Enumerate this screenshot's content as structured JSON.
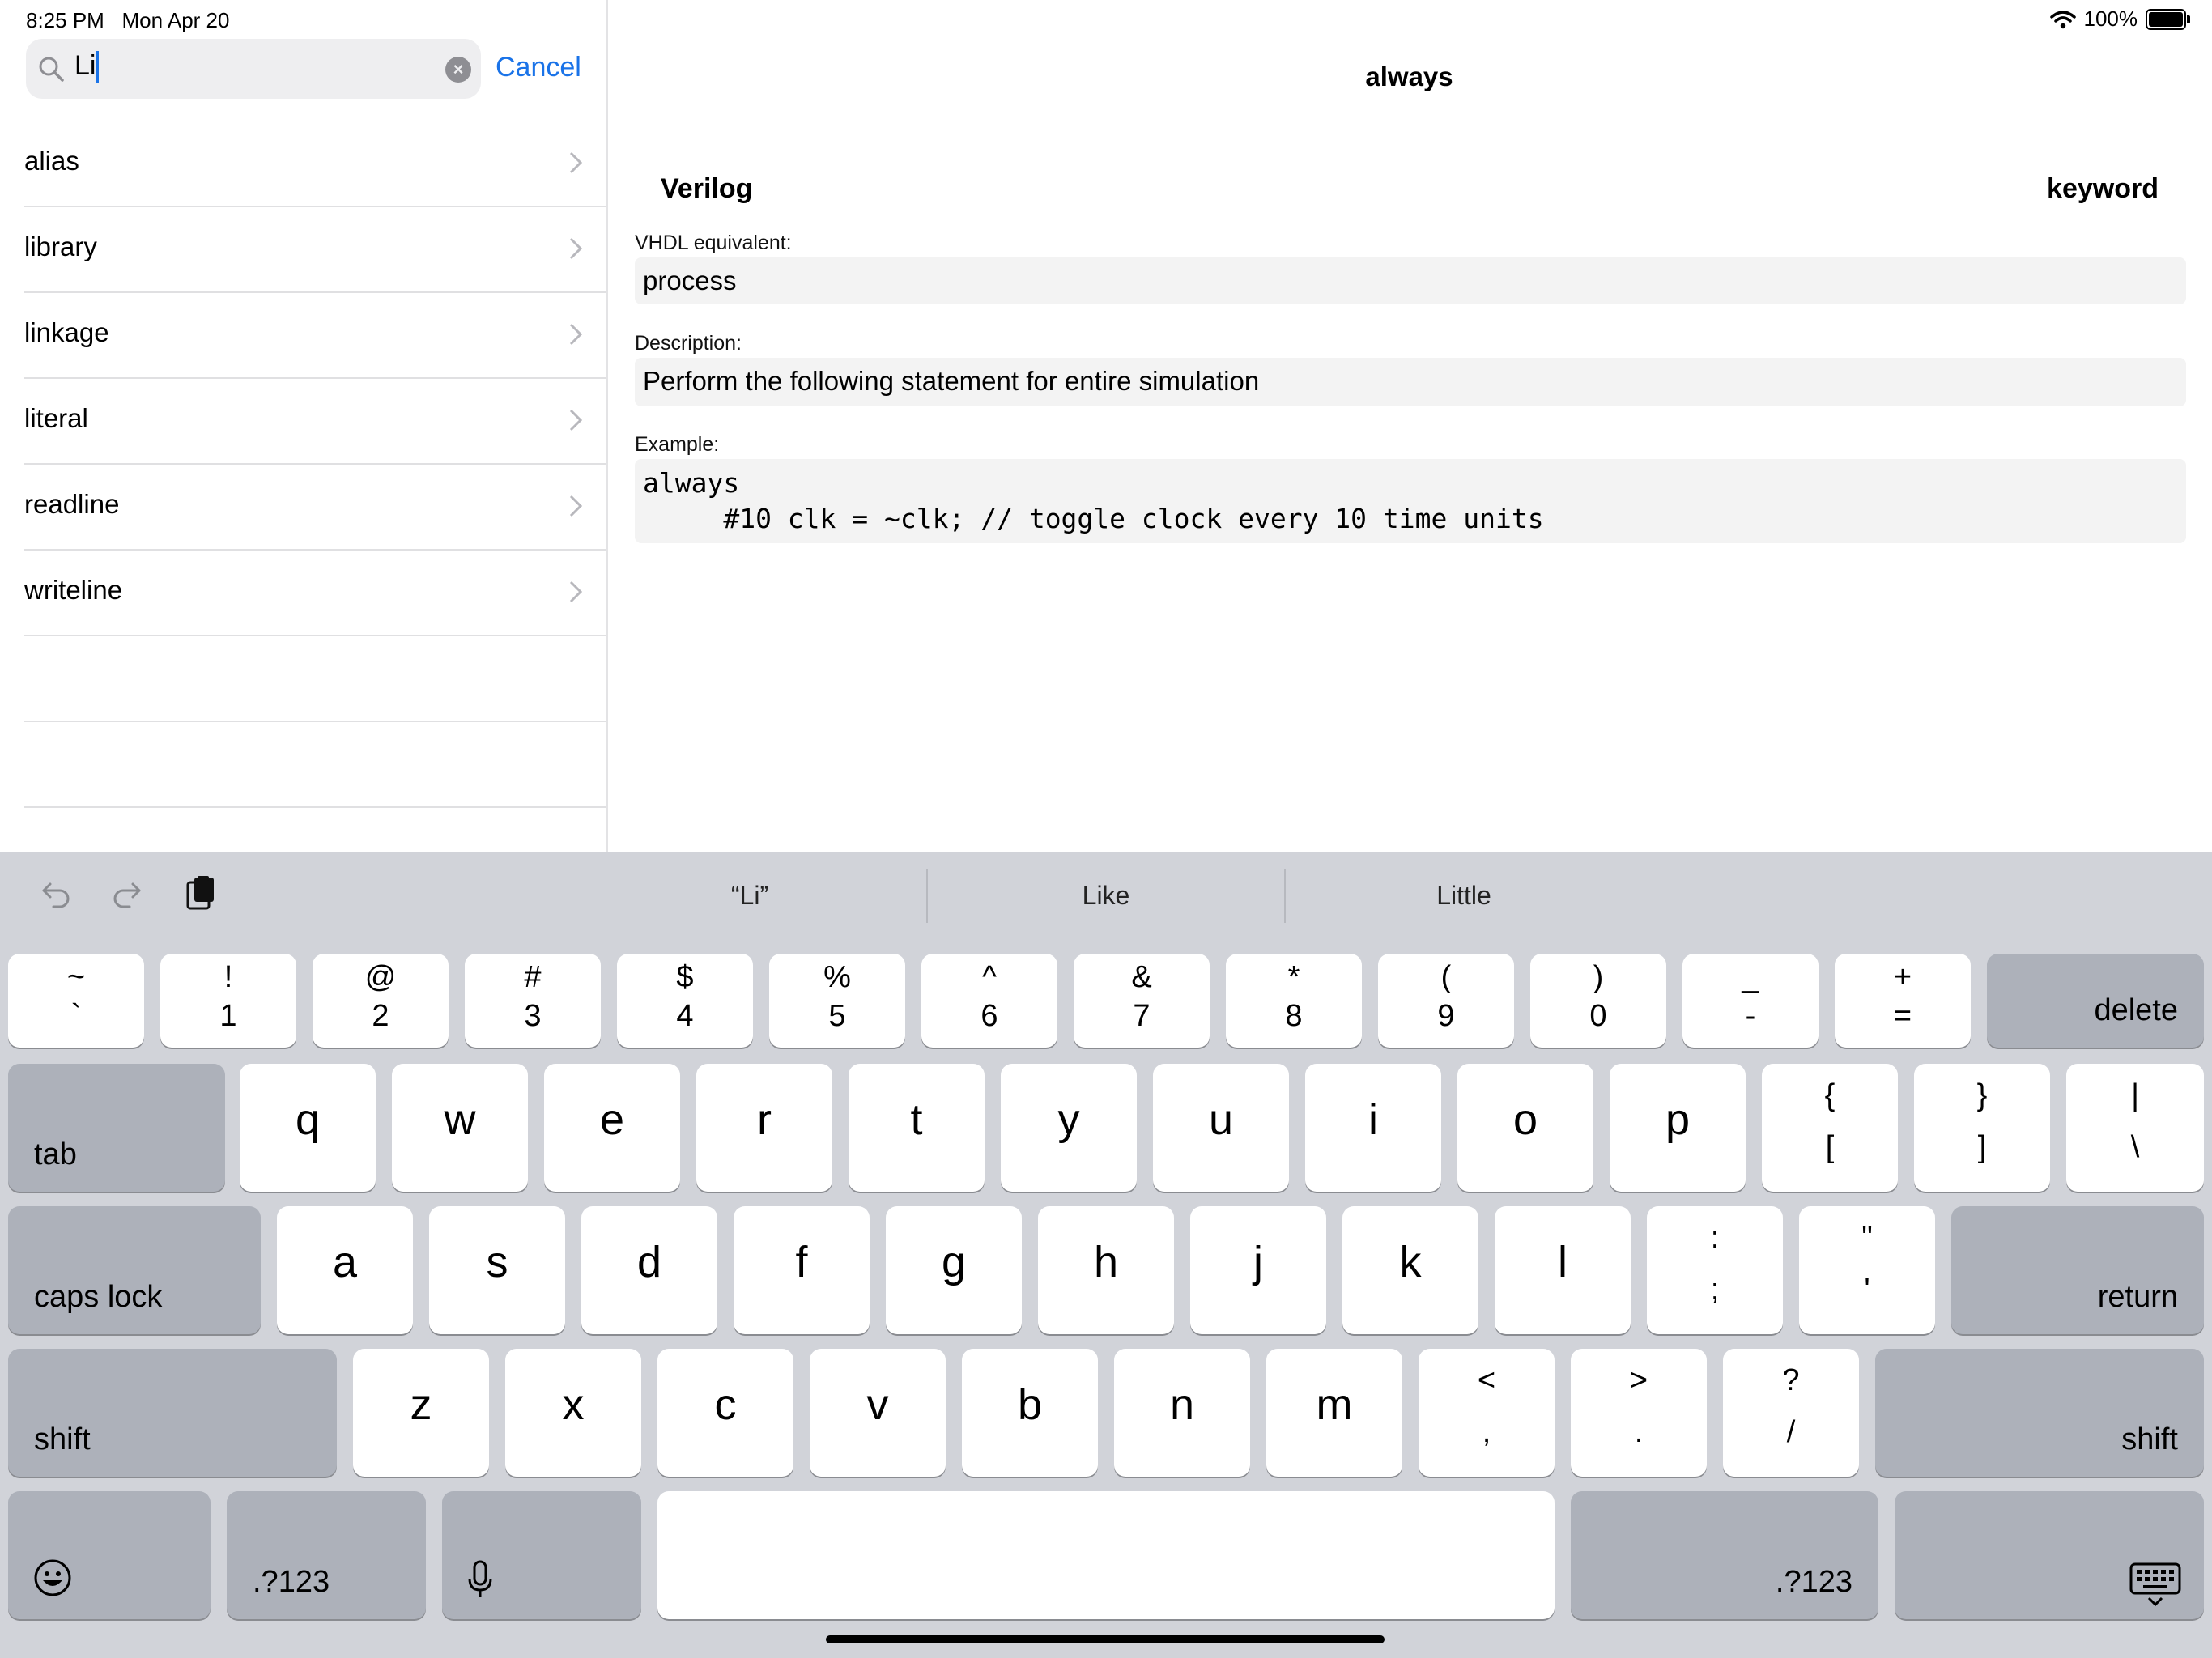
{
  "status": {
    "time": "8:25 PM",
    "date": "Mon Apr 20",
    "battery": "100%"
  },
  "search": {
    "value": "Li",
    "cancel": "Cancel"
  },
  "results": [
    "alias",
    "library",
    "linkage",
    "literal",
    "readline",
    "writeline"
  ],
  "detail": {
    "title": "always",
    "language": "Verilog",
    "kind": "keyword",
    "vhdl_label": "VHDL equivalent:",
    "vhdl_value": "process",
    "desc_label": "Description:",
    "desc_value": "Perform the following statement for entire simulation",
    "example_label": "Example:",
    "example_line1": "always",
    "example_line2": "     #10 clk = ~clk; // toggle clock every 10 time units"
  },
  "keyboard": {
    "suggestions": [
      "“Li”",
      "Like",
      "Little"
    ],
    "number_row": [
      {
        "top": "~",
        "bottom": "`"
      },
      {
        "top": "!",
        "bottom": "1"
      },
      {
        "top": "@",
        "bottom": "2"
      },
      {
        "top": "#",
        "bottom": "3"
      },
      {
        "top": "$",
        "bottom": "4"
      },
      {
        "top": "%",
        "bottom": "5"
      },
      {
        "top": "^",
        "bottom": "6"
      },
      {
        "top": "&",
        "bottom": "7"
      },
      {
        "top": "*",
        "bottom": "8"
      },
      {
        "top": "(",
        "bottom": "9"
      },
      {
        "top": ")",
        "bottom": "0"
      },
      {
        "top": "_",
        "bottom": "-"
      },
      {
        "top": "+",
        "bottom": "="
      }
    ],
    "delete": "delete",
    "tab": "tab",
    "row_q": [
      "q",
      "w",
      "e",
      "r",
      "t",
      "y",
      "u",
      "i",
      "o",
      "p"
    ],
    "row_q_sym": [
      {
        "top": "{",
        "bottom": "["
      },
      {
        "top": "}",
        "bottom": "]"
      },
      {
        "top": "|",
        "bottom": "\\"
      }
    ],
    "caps_lock": "caps lock",
    "row_a": [
      "a",
      "s",
      "d",
      "f",
      "g",
      "h",
      "j",
      "k",
      "l"
    ],
    "row_a_sym": [
      {
        "top": ":",
        "bottom": ";"
      },
      {
        "top": "\"",
        "bottom": "'"
      }
    ],
    "return": "return",
    "shift": "shift",
    "row_z": [
      "z",
      "x",
      "c",
      "v",
      "b",
      "n",
      "m"
    ],
    "row_z_sym": [
      {
        "top": "<",
        "bottom": ","
      },
      {
        "top": ">",
        "bottom": "."
      },
      {
        "top": "?",
        "bottom": "/"
      }
    ],
    "num_switch": ".?123"
  }
}
